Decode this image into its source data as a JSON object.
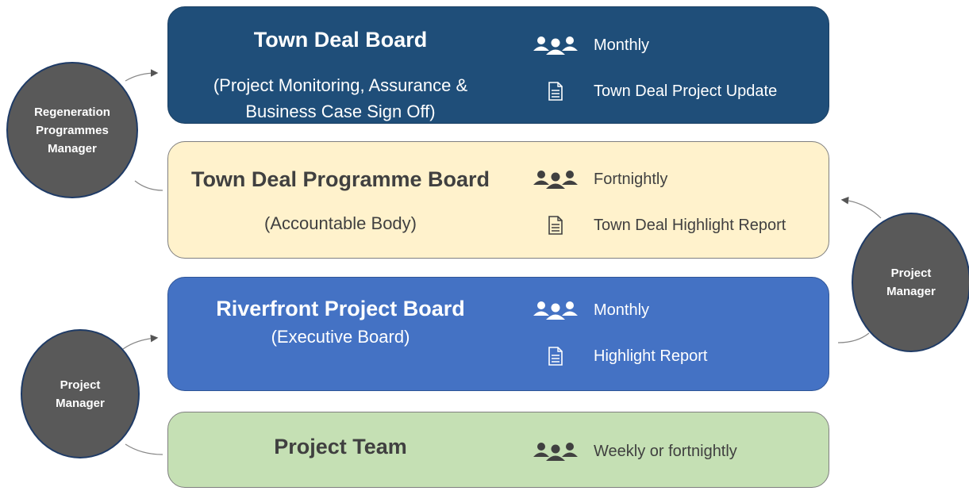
{
  "boards": [
    {
      "title": "Town Deal Board",
      "subtitle_lines": [
        "(Project Monitoring, Assurance &",
        "Business Case Sign Off)"
      ],
      "meeting": "Monthly",
      "report": "Town Deal Project Update"
    },
    {
      "title": "Town Deal Programme Board",
      "subtitle_lines": [
        "(Accountable Body)"
      ],
      "meeting": "Fortnightly",
      "report": "Town Deal Highlight Report"
    },
    {
      "title": "Riverfront Project Board",
      "subtitle_lines": [
        "(Executive Board)"
      ],
      "meeting": "Monthly",
      "report": "Highlight Report"
    },
    {
      "title": "Project Team",
      "meeting": "Weekly or fortnightly"
    }
  ],
  "roles": {
    "regeneration_manager": [
      "Regeneration",
      "Programmes",
      "Manager"
    ],
    "project_manager_right": [
      "Project",
      "Manager"
    ],
    "project_manager_left": [
      "Project",
      "Manager"
    ]
  },
  "icons": {
    "meeting": "people-group-icon",
    "report": "document-icon"
  },
  "colors": {
    "town_deal_board": "#1f4e79",
    "programme_board": "#fff2cc",
    "project_board": "#4472c4",
    "project_team": "#c5e0b4",
    "role_circle": "#595959"
  }
}
